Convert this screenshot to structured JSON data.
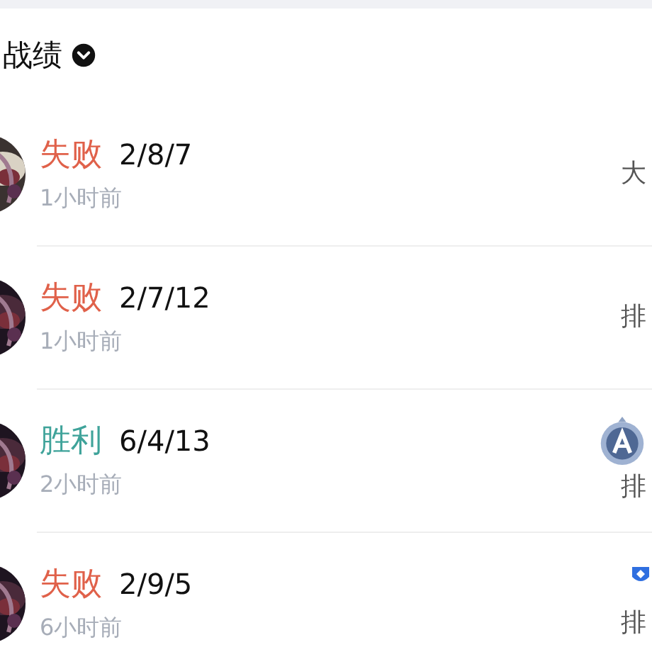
{
  "section": {
    "title": "战绩"
  },
  "matches": [
    {
      "result": "失败",
      "color": "#e0614a",
      "kda": "2/8/7",
      "time": "1小时前",
      "mode": "大"
    },
    {
      "result": "失败",
      "color": "#e0614a",
      "kda": "2/7/12",
      "time": "1小时前",
      "mode": "排"
    },
    {
      "result": "胜利",
      "color": "#3fa39a",
      "kda": "6/4/13",
      "time": "2小时前",
      "mode": "排",
      "badge": {
        "kind": "rank"
      }
    },
    {
      "result": "失败",
      "color": "#e0614a",
      "kda": "2/9/5",
      "time": "6小时前",
      "mode": "排",
      "badge": {
        "kind": "shield"
      }
    }
  ]
}
